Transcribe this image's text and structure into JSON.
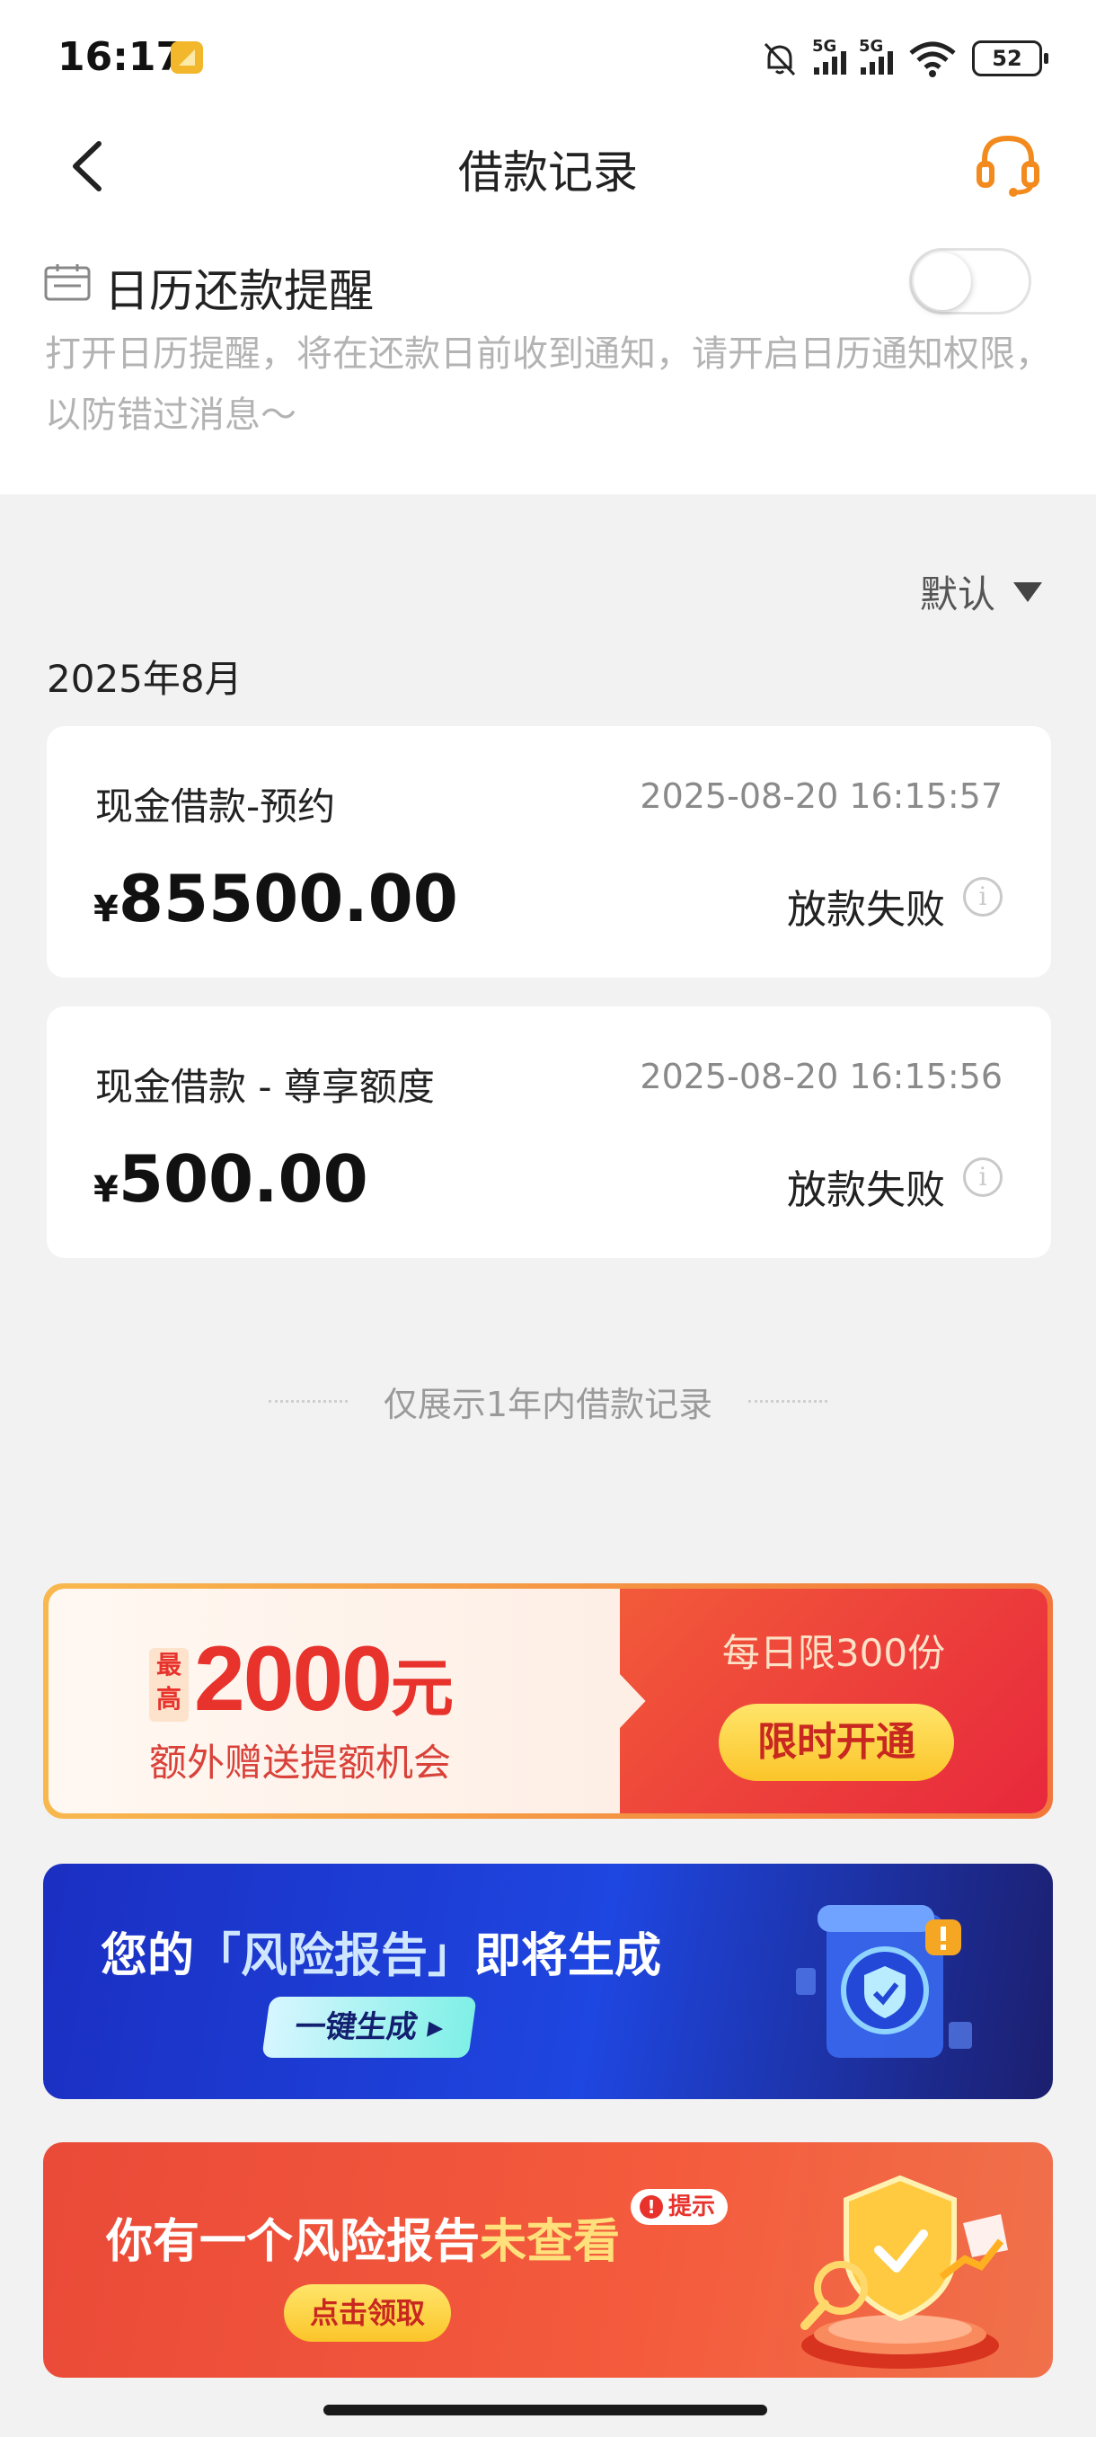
{
  "status_bar": {
    "time": "16:17",
    "signal1_label": "5G",
    "signal2_label": "5G",
    "battery": "52"
  },
  "nav": {
    "title": "借款记录"
  },
  "reminder": {
    "title": "日历还款提醒",
    "enabled": false,
    "description": "打开日历提醒，将在还款日前收到通知，请开启日历通知权限，以防错过消息～"
  },
  "sort": {
    "label": "默认"
  },
  "month_header": "2025年8月",
  "loans": [
    {
      "name": "现金借款-预约",
      "time": "2025-08-20 16:15:57",
      "currency": "¥",
      "amount": "85500.00",
      "status": "放款失败",
      "info_glyph": "i"
    },
    {
      "name": "现金借款 - 尊享额度",
      "time": "2025-08-20 16:15:56",
      "currency": "¥",
      "amount": "500.00",
      "status": "放款失败",
      "info_glyph": "i"
    }
  ],
  "footer_note": "仅展示1年内借款记录",
  "banners": {
    "boost": {
      "tag": "最高",
      "amount": "2000",
      "unit": "元",
      "subtitle": "额外赠送提额机会",
      "limit": "每日限300份",
      "button": "限时开通"
    },
    "risk_report": {
      "title_pre": "您的",
      "title_highlight": "「风险报告」",
      "title_post": "即将生成",
      "button": "一键生成 ▸"
    },
    "unviewed": {
      "title_pre": "你有一个风险报告",
      "title_highlight": "未查看",
      "tip_glyph": "!",
      "tip": "提示",
      "button": "点击领取"
    }
  },
  "colors": {
    "accent_orange": "#f28a1e",
    "banner_red": "#e8322c",
    "banner_blue": "#1e46e0"
  }
}
